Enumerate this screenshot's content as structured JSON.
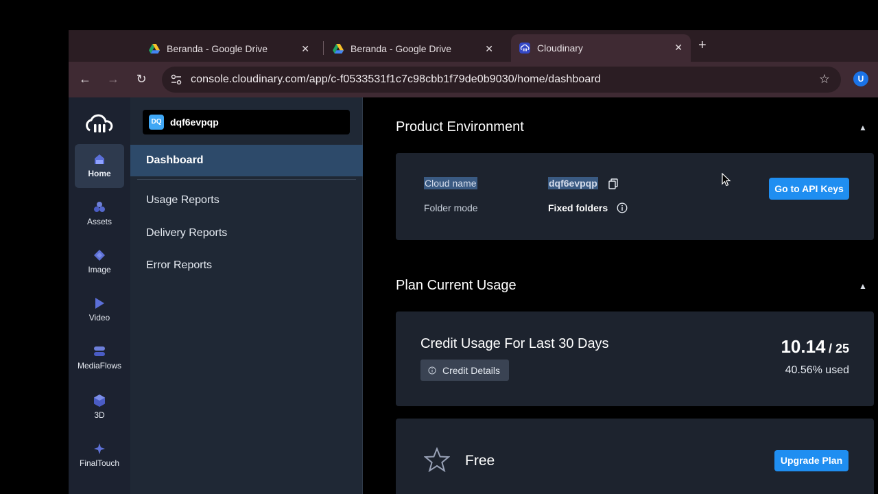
{
  "browser": {
    "tabs": [
      {
        "label": "Beranda - Google Drive",
        "icon": "google-drive-icon"
      },
      {
        "label": "Beranda - Google Drive",
        "icon": "google-drive-icon"
      },
      {
        "label": "Cloudinary",
        "icon": "cloudinary-icon",
        "active": true
      }
    ],
    "url": "console.cloudinary.com/app/c-f0533531f1c7c98cbb1f79de0b9030/home/dashboard",
    "profile_initial": "U"
  },
  "rail": {
    "items": [
      {
        "label": "Home",
        "icon": "home-icon",
        "active": true
      },
      {
        "label": "Assets",
        "icon": "assets-icon"
      },
      {
        "label": "Image",
        "icon": "image-icon"
      },
      {
        "label": "Video",
        "icon": "video-icon"
      },
      {
        "label": "MediaFlows",
        "icon": "mediaflows-icon"
      },
      {
        "label": "3D",
        "icon": "3d-icon"
      },
      {
        "label": "FinalTouch",
        "icon": "finaltouch-icon"
      }
    ]
  },
  "subnav": {
    "env_badge": "DQ",
    "env_name": "dqf6evpqp",
    "active": "Dashboard",
    "links": [
      "Usage Reports",
      "Delivery Reports",
      "Error Reports"
    ]
  },
  "product_env": {
    "title": "Product Environment",
    "cloud_name_label": "Cloud name",
    "cloud_name_value": "dqf6evpqp",
    "folder_mode_label": "Folder mode",
    "folder_mode_value": "Fixed folders",
    "api_keys_button": "Go to API Keys"
  },
  "plan_usage": {
    "title": "Plan Current Usage",
    "credit_title": "Credit Usage For Last 30 Days",
    "credit_details_button": "Credit Details",
    "used": "10.14",
    "total": "/ 25",
    "percent_used": "40.56% used"
  },
  "plan": {
    "name": "Free",
    "upgrade_button": "Upgrade Plan"
  },
  "colors": {
    "accent": "#1f8ef1",
    "rail_bg": "#1c2230",
    "subnav_bg": "#1f2835",
    "card_bg": "#1d232e",
    "tab_bg": "#2b1d23",
    "toolbar_bg": "#3f2a33"
  }
}
